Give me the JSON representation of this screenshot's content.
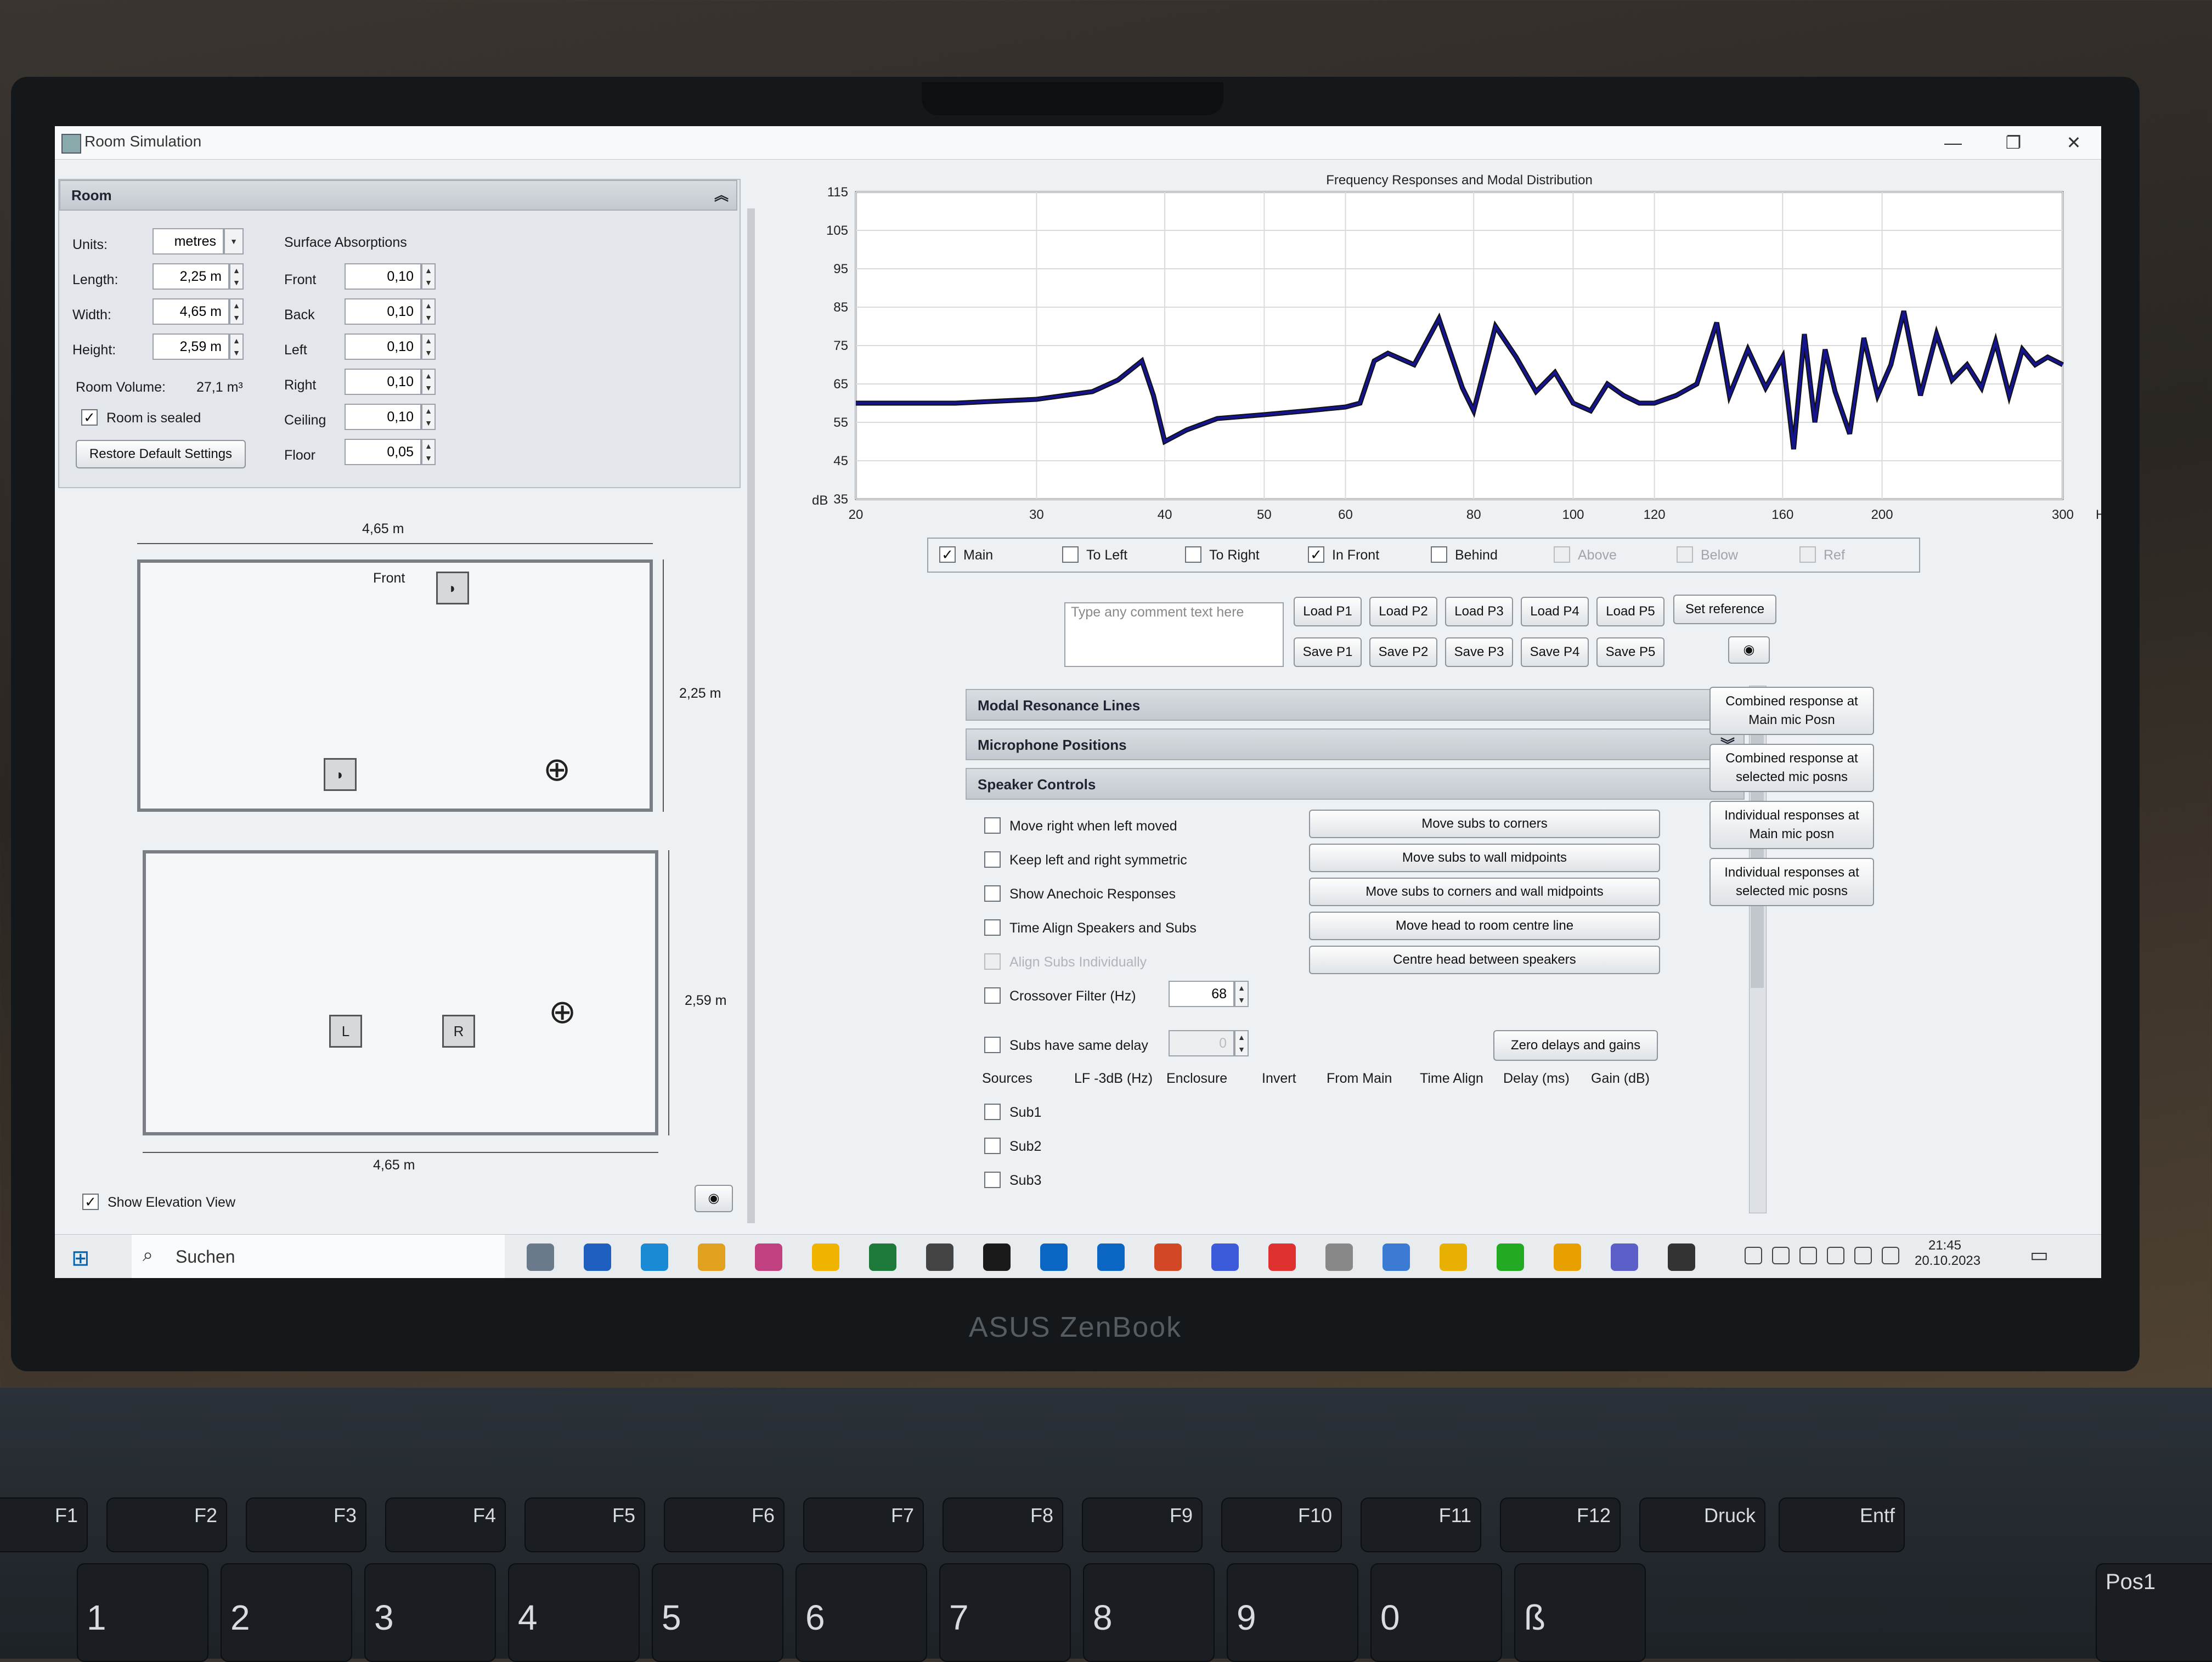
{
  "brand": "ASUS ZenBook",
  "window": {
    "title": "Room Simulation",
    "minimize": "—",
    "restore": "❐",
    "close": "✕"
  },
  "room_panel": {
    "header": "Room",
    "units_label": "Units:",
    "units_value": "metres",
    "length_label": "Length:",
    "length_value": "2,25 m",
    "width_label": "Width:",
    "width_value": "4,65 m",
    "height_label": "Height:",
    "height_value": "2,59 m",
    "volume_label": "Room Volume:",
    "volume_value": "27,1 m³",
    "sealed_label": "Room is sealed",
    "sealed_checked": "✓",
    "restore_button": "Restore Default Settings",
    "absorptions_title": "Surface Absorptions",
    "absorptions": [
      {
        "label": "Front",
        "value": "0,10"
      },
      {
        "label": "Back",
        "value": "0,10"
      },
      {
        "label": "Left",
        "value": "0,10"
      },
      {
        "label": "Right",
        "value": "0,10"
      },
      {
        "label": "Ceiling",
        "value": "0,10"
      },
      {
        "label": "Floor",
        "value": "0,05"
      }
    ]
  },
  "plan_view": {
    "top_dim": "4,65 m",
    "side_dim": "2,25 m",
    "front_label": "Front"
  },
  "elevation_view": {
    "side_dim": "2,59 m",
    "bottom_dim": "4,65 m",
    "left_spk": "L",
    "right_spk": "R"
  },
  "show_elevation": {
    "label": "Show Elevation View",
    "checked": "✓"
  },
  "chart_data": {
    "type": "line",
    "title": "Frequency Responses and Modal Distribution",
    "ylabel": "dB",
    "xlabel": "Hz",
    "y_ticks": [
      "115",
      "105",
      "95",
      "85",
      "75",
      "65",
      "55",
      "45",
      "35"
    ],
    "x_ticks": [
      "20",
      "30",
      "40",
      "50",
      "60",
      "80",
      "100",
      "120",
      "160",
      "200",
      "300"
    ],
    "ylim": [
      35,
      115
    ],
    "xlim": [
      20,
      300
    ],
    "xscale": "log",
    "series": [
      {
        "name": "Main",
        "color": "#14148c",
        "x": [
          20,
          25,
          30,
          34,
          36,
          38,
          39,
          40,
          42,
          45,
          50,
          55,
          60,
          62,
          64,
          66,
          70,
          74,
          78,
          80,
          84,
          88,
          92,
          96,
          100,
          104,
          108,
          112,
          116,
          120,
          126,
          132,
          138,
          142,
          148,
          154,
          160,
          164,
          168,
          172,
          176,
          180,
          186,
          192,
          198,
          204,
          210,
          218,
          226,
          234,
          242,
          250,
          258,
          266,
          274,
          282,
          290,
          300
        ],
        "y": [
          60,
          60,
          61,
          63,
          66,
          71,
          62,
          50,
          53,
          56,
          57,
          58,
          59,
          60,
          71,
          73,
          70,
          82,
          64,
          58,
          80,
          72,
          63,
          68,
          60,
          58,
          65,
          62,
          60,
          60,
          62,
          65,
          81,
          62,
          74,
          64,
          72,
          48,
          78,
          55,
          74,
          63,
          52,
          77,
          62,
          70,
          84,
          62,
          78,
          66,
          70,
          64,
          76,
          62,
          74,
          70,
          72,
          70
        ]
      }
    ],
    "legend_position": "bottom",
    "grid": true
  },
  "legend": [
    {
      "label": "Main",
      "checked": "✓",
      "state": "on"
    },
    {
      "label": "To Left",
      "checked": "",
      "state": "on"
    },
    {
      "label": "To Right",
      "checked": "",
      "state": "on"
    },
    {
      "label": "In Front",
      "checked": "✓",
      "state": "on"
    },
    {
      "label": "Behind",
      "checked": "",
      "state": "on"
    },
    {
      "label": "Above",
      "checked": "",
      "state": "off"
    },
    {
      "label": "Below",
      "checked": "",
      "state": "off"
    },
    {
      "label": "Ref",
      "checked": "",
      "state": "off"
    }
  ],
  "comment_placeholder": "Type any comment text here",
  "load_buttons": [
    "Load P1",
    "Load P2",
    "Load P3",
    "Load P4",
    "Load P5"
  ],
  "save_buttons": [
    "Save P1",
    "Save P2",
    "Save P3",
    "Save P4",
    "Save P5"
  ],
  "set_reference": "Set reference",
  "sections": {
    "modal": "Modal Resonance Lines",
    "mic": "Microphone Positions",
    "speaker": "Speaker Controls"
  },
  "speaker_controls": {
    "checks": [
      {
        "label": "Move right when left moved",
        "state": "on"
      },
      {
        "label": "Keep left and right symmetric",
        "state": "on"
      },
      {
        "label": "Show Anechoic Responses",
        "state": "on"
      },
      {
        "label": "Time Align Speakers and Subs",
        "state": "on"
      },
      {
        "label": "Align Subs Individually",
        "state": "off"
      }
    ],
    "crossover_label": "Crossover Filter (Hz)",
    "crossover_value": "68",
    "same_delay_label": "Subs have same delay",
    "same_delay_value": "0",
    "action_buttons": [
      "Move subs to corners",
      "Move subs to wall midpoints",
      "Move subs to corners and wall midpoints",
      "Move head to room centre line",
      "Centre head between speakers"
    ],
    "zero_button": "Zero delays and gains",
    "columns": [
      "Sources",
      "LF -3dB (Hz)",
      "Enclosure",
      "Invert",
      "From Main",
      "Time Align",
      "Delay (ms)",
      "Gain (dB)"
    ],
    "subs": [
      "Sub1",
      "Sub2",
      "Sub3"
    ]
  },
  "response_buttons": [
    "Combined response at Main mic Posn",
    "Combined response at selected mic posns",
    "Individual responses at Main mic posn",
    "Individual responses at selected mic posns"
  ],
  "taskbar": {
    "search": "Suchen",
    "time": "21:45",
    "date": "20.10.2023"
  },
  "keys_fn": [
    "F1",
    "F2",
    "F3",
    "F4",
    "F5",
    "F6",
    "F7",
    "F8",
    "F9",
    "F10",
    "F11",
    "F12",
    "Druck",
    "Entf"
  ],
  "keys_num": [
    "1",
    "2",
    "3",
    "4",
    "5",
    "6",
    "7",
    "8",
    "9",
    "0",
    "ß"
  ],
  "key_pos1": "Pos1"
}
